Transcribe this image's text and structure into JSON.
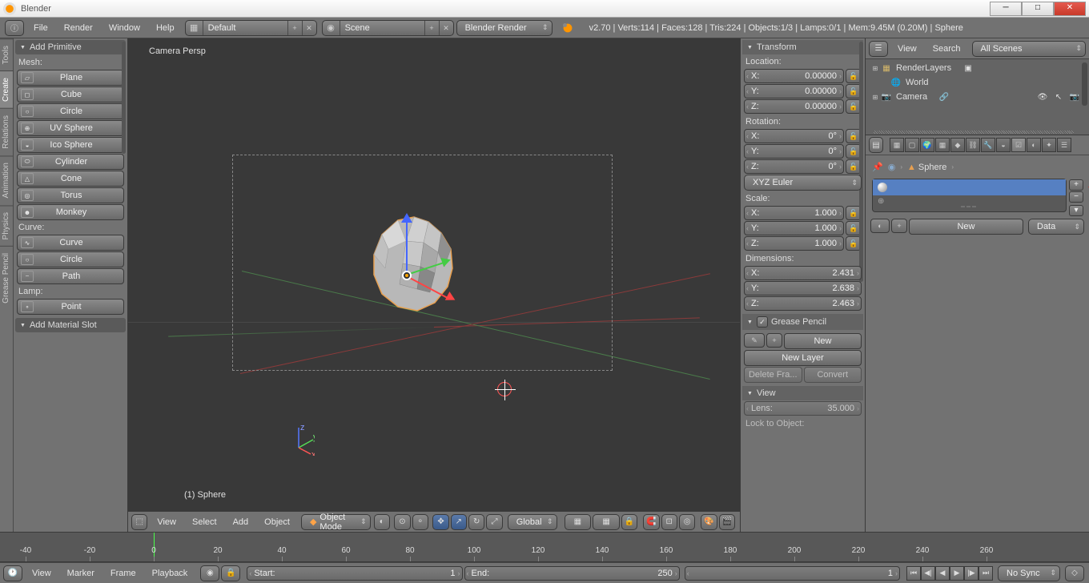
{
  "window": {
    "title": "Blender",
    "min": "─",
    "max": "□",
    "close": "✕"
  },
  "topbar": {
    "menus": [
      "File",
      "Render",
      "Window",
      "Help"
    ],
    "layout_field": "Default",
    "scene_field": "Scene",
    "engine": "Blender Render",
    "status": "v2.70 | Verts:114 | Faces:128 | Tris:224 | Objects:1/3 | Lamps:0/1 | Mem:9.45M (0.20M) | Sphere"
  },
  "vtabs": [
    "Tools",
    "Create",
    "Relations",
    "Animation",
    "Physics",
    "Grease Pencil"
  ],
  "tool_panel": {
    "header": "Add Primitive",
    "mesh_label": "Mesh:",
    "meshes": [
      "Plane",
      "Cube",
      "Circle",
      "UV Sphere",
      "Ico Sphere",
      "Cylinder",
      "Cone",
      "Torus",
      "Monkey"
    ],
    "curve_label": "Curve:",
    "curves": [
      "Curve",
      "Circle",
      "Path"
    ],
    "lamp_label": "Lamp:",
    "lamps": [
      "Point"
    ],
    "op_header": "Add Material Slot"
  },
  "viewport": {
    "persp": "Camera Persp",
    "obj_name": "(1) Sphere",
    "header": {
      "menus": [
        "View",
        "Select",
        "Add",
        "Object"
      ],
      "mode": "Object Mode",
      "orientation": "Global"
    }
  },
  "npanel": {
    "transform_hdr": "Transform",
    "location_lbl": "Location:",
    "location": [
      {
        "l": "X:",
        "v": "0.00000"
      },
      {
        "l": "Y:",
        "v": "0.00000"
      },
      {
        "l": "Z:",
        "v": "0.00000"
      }
    ],
    "rotation_lbl": "Rotation:",
    "rotation": [
      {
        "l": "X:",
        "v": "0°"
      },
      {
        "l": "Y:",
        "v": "0°"
      },
      {
        "l": "Z:",
        "v": "0°"
      }
    ],
    "rot_mode": "XYZ Euler",
    "scale_lbl": "Scale:",
    "scale": [
      {
        "l": "X:",
        "v": "1.000"
      },
      {
        "l": "Y:",
        "v": "1.000"
      },
      {
        "l": "Z:",
        "v": "1.000"
      }
    ],
    "dims_lbl": "Dimensions:",
    "dims": [
      {
        "l": "X:",
        "v": "2.431"
      },
      {
        "l": "Y:",
        "v": "2.638"
      },
      {
        "l": "Z:",
        "v": "2.463"
      }
    ],
    "gp_hdr": "Grease Pencil",
    "gp_new": "New",
    "gp_layer": "New Layer",
    "gp_del": "Delete Fra...",
    "gp_conv": "Convert",
    "view_hdr": "View",
    "lens_lbl": "Lens:",
    "lens_val": "35.000",
    "lock_lbl": "Lock to Object:"
  },
  "outliner": {
    "view": "View",
    "search": "Search",
    "allscenes": "All Scenes",
    "tree": [
      {
        "indent": 0,
        "exp": "⊞",
        "icon": "▦",
        "label": "RenderLayers",
        "tail_icon": "▣"
      },
      {
        "indent": 0,
        "exp": "",
        "icon": "🌐",
        "label": "World",
        "tail_icon": ""
      },
      {
        "indent": 0,
        "exp": "⊞",
        "icon": "📷",
        "label": "Camera",
        "tail_icon": "🔗"
      }
    ]
  },
  "props": {
    "tabs": [
      "▦",
      "▢",
      "🌍",
      "▦",
      "◆",
      "⛓",
      "🔧",
      "◒",
      "☑",
      "◐",
      "✦",
      "☰"
    ],
    "bc_obj": "Sphere",
    "new_btn": "New",
    "data_btn": "Data"
  },
  "timeline": {
    "ticks": [
      "-40",
      "-20",
      "0",
      "20",
      "40",
      "60",
      "80",
      "100",
      "120",
      "140",
      "160",
      "180",
      "200",
      "220",
      "240",
      "260"
    ],
    "hdr": {
      "menus": [
        "View",
        "Marker",
        "Frame",
        "Playback"
      ],
      "start_lbl": "Start:",
      "start": "1",
      "end_lbl": "End:",
      "end": "250",
      "cur": "1",
      "sync": "No Sync"
    }
  }
}
